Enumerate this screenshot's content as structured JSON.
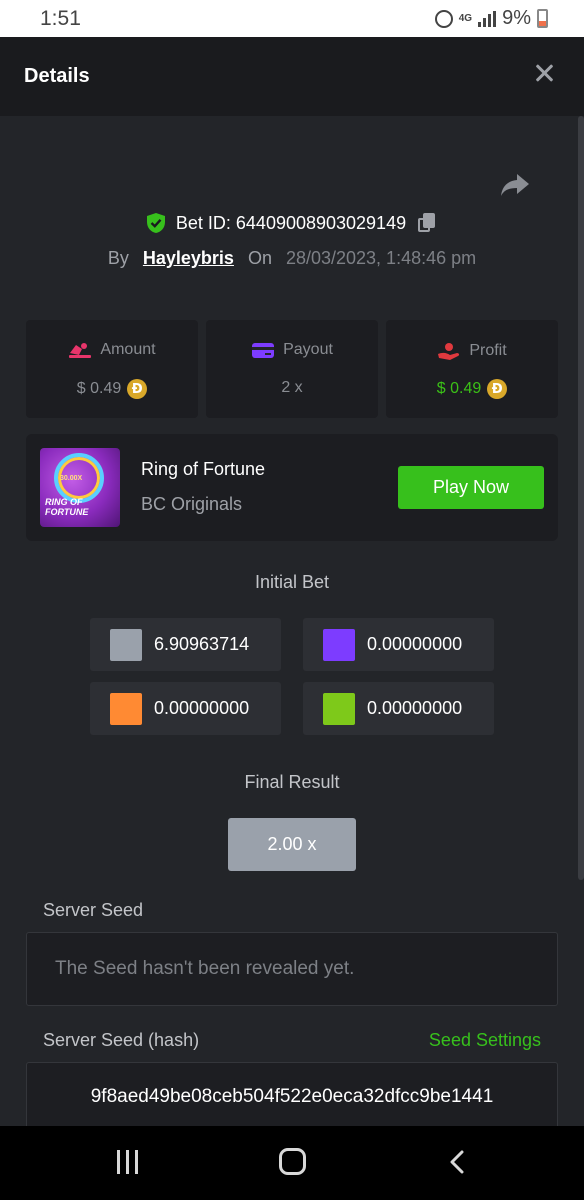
{
  "status_bar": {
    "time": "1:51",
    "network": "4G",
    "battery": "9%"
  },
  "header": {
    "title": "Details"
  },
  "bet": {
    "id_label": "Bet ID: 64409008903029149",
    "by_label": "By",
    "user": "Hayleybris",
    "on_label": "On",
    "date": "28/03/2023, 1:48:46 pm"
  },
  "stats": {
    "amount": {
      "label": "Amount",
      "value": "$ 0.49"
    },
    "payout": {
      "label": "Payout",
      "value": "2 x"
    },
    "profit": {
      "label": "Profit",
      "value": "$ 0.49"
    },
    "coin_symbol": "Đ"
  },
  "game": {
    "thumb_multiplier": "30.00X",
    "thumb_title_1": "RING OF",
    "thumb_title_2": "FORTUNE",
    "name": "Ring of Fortune",
    "provider": "BC Originals",
    "play_label": "Play Now"
  },
  "initial_bet": {
    "title": "Initial Bet",
    "items": [
      {
        "color": "#9aa1ab",
        "value": "6.90963714"
      },
      {
        "color": "#7d3cff",
        "value": "0.00000000"
      },
      {
        "color": "#ff8a33",
        "value": "0.00000000"
      },
      {
        "color": "#7ec91a",
        "value": "0.00000000"
      }
    ]
  },
  "final_result": {
    "title": "Final Result",
    "value": "2.00 x"
  },
  "server_seed": {
    "label": "Server Seed",
    "value": "The Seed hasn't been revealed yet.",
    "hash_label": "Server Seed (hash)",
    "seed_settings": "Seed Settings",
    "hash": "9f8aed49be08ceb504f522e0eca32dfcc9be1441"
  },
  "colors": {
    "accent_green": "#37c01c",
    "background": "#232529",
    "card": "#1c1d21"
  }
}
